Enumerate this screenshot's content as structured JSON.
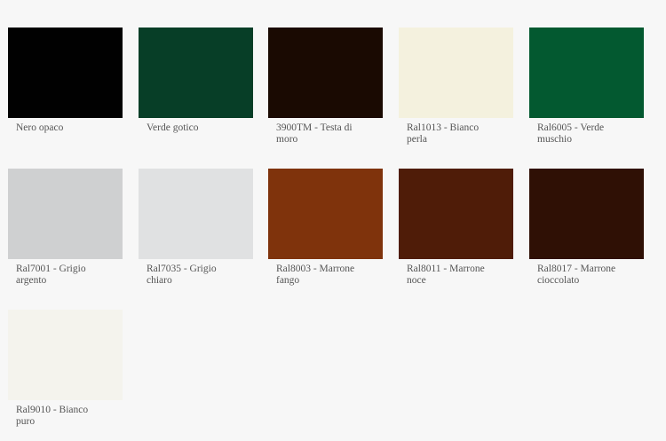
{
  "swatches": [
    {
      "label": "Nero opaco",
      "color": "#010101"
    },
    {
      "label": "Verde gotico",
      "color": "#073e27"
    },
    {
      "label": "3900TM - Testa di\nmoro",
      "color": "#1a0a02"
    },
    {
      "label": "Ral1013 - Bianco\nperla",
      "color": "#f4f1de"
    },
    {
      "label": "Ral6005 - Verde\nmuschio",
      "color": "#035930"
    },
    {
      "label": "Ral7001 - Grigio\nargento",
      "color": "#cfd0d1"
    },
    {
      "label": "Ral7035 - Grigio\nchiaro",
      "color": "#e0e1e2"
    },
    {
      "label": "Ral8003 - Marrone\nfango",
      "color": "#7f330c"
    },
    {
      "label": "Ral8011 - Marrone\nnoce",
      "color": "#4f1c08"
    },
    {
      "label": "Ral8017 - Marrone\ncioccolato",
      "color": "#2f1005"
    },
    {
      "label": "Ral9010 - Bianco\npuro",
      "color": "#f4f3ed"
    }
  ]
}
